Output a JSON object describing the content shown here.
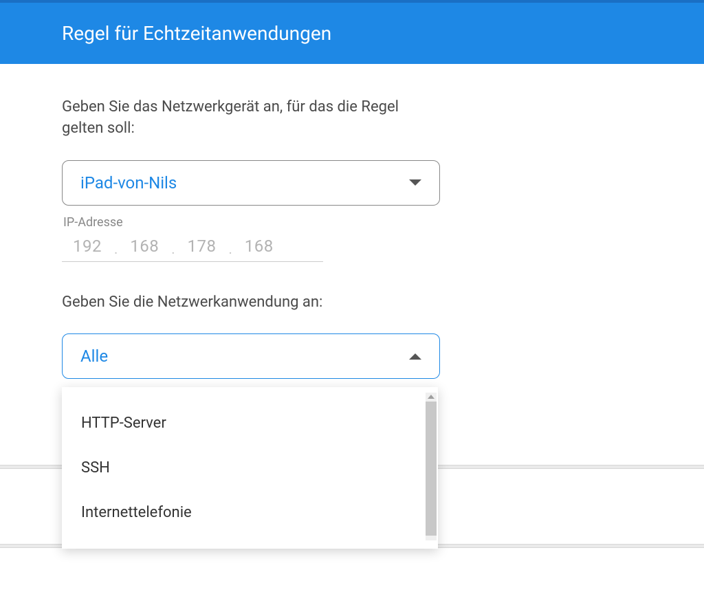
{
  "header": {
    "title": "Regel für Echtzeitanwendungen"
  },
  "device": {
    "instruction": "Geben Sie das Netzwerkgerät an, für das die Regel gelten soll:",
    "selected": "iPad-von-Nils"
  },
  "ip": {
    "label": "IP-Adresse",
    "octet1": "192",
    "octet2": "168",
    "octet3": "178",
    "octet4": "168",
    "sep": "."
  },
  "app": {
    "instruction": "Geben Sie die Netzwerkanwendung an:",
    "selected": "Alle",
    "options": {
      "0": "HTTP-Server",
      "1": "SSH",
      "2": "Internettelefonie"
    }
  }
}
